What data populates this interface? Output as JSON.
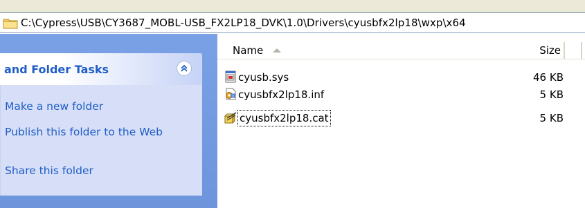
{
  "address_bar": {
    "path": "C:\\Cypress\\USB\\CY3687_MOBL-USB_FX2LP18_DVK\\1.0\\Drivers\\cyusbfx2lp18\\wxp\\x64",
    "icon": "folder-icon"
  },
  "tasks": {
    "header": "and Folder Tasks",
    "collapse_icon": "chevron-double-up-icon",
    "links": [
      "Make a new folder",
      "Publish this folder to the Web",
      "Share this folder"
    ]
  },
  "file_list": {
    "columns": {
      "name": "Name",
      "size": "Size"
    },
    "sort": "ascending",
    "files": [
      {
        "name": "cyusb.sys",
        "size": "46 KB",
        "icon": "system-file-icon"
      },
      {
        "name": "cyusbfx2lp18.inf",
        "size": "5 KB",
        "icon": "setup-info-icon"
      },
      {
        "name": "cyusbfx2lp18.cat",
        "size": "5 KB",
        "icon": "security-catalog-icon",
        "selected": true
      }
    ]
  }
}
